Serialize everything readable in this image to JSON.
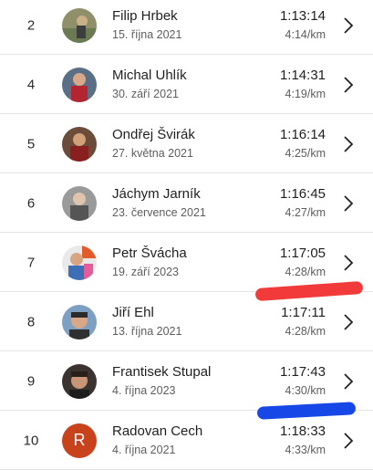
{
  "rows": [
    {
      "rank": "2",
      "name": "Filip Hrbek",
      "date": "15. října 2021",
      "time": "1:13:14",
      "pace": "4:14/km"
    },
    {
      "rank": "4",
      "name": "Michal Uhlík",
      "date": "30. září 2021",
      "time": "1:14:31",
      "pace": "4:19/km"
    },
    {
      "rank": "5",
      "name": "Ondřej Švirák",
      "date": "27. května 2021",
      "time": "1:16:14",
      "pace": "4:25/km"
    },
    {
      "rank": "6",
      "name": "Jáchym Jarník",
      "date": "23. července 2021",
      "time": "1:16:45",
      "pace": "4:27/km"
    },
    {
      "rank": "7",
      "name": "Petr Švácha",
      "date": "19. září 2023",
      "time": "1:17:05",
      "pace": "4:28/km"
    },
    {
      "rank": "8",
      "name": "Jiří Ehl",
      "date": "13. října 2021",
      "time": "1:17:11",
      "pace": "4:28/km"
    },
    {
      "rank": "9",
      "name": "Frantisek Stupal",
      "date": "4. října 2023",
      "time": "1:17:43",
      "pace": "4:30/km"
    },
    {
      "rank": "10",
      "name": "Radovan Cech",
      "date": "4. října 2021",
      "time": "1:18:33",
      "pace": "4:33/km",
      "avatar_letter": "R"
    }
  ],
  "icons": {
    "row_chevron": "chevron-right-icon",
    "avatar_photo": "user-photo-icon"
  },
  "colors": {
    "red_mark": "#f23a3a",
    "blue_mark": "#1747e6",
    "avatar_letter_bg": "#c8431b"
  }
}
